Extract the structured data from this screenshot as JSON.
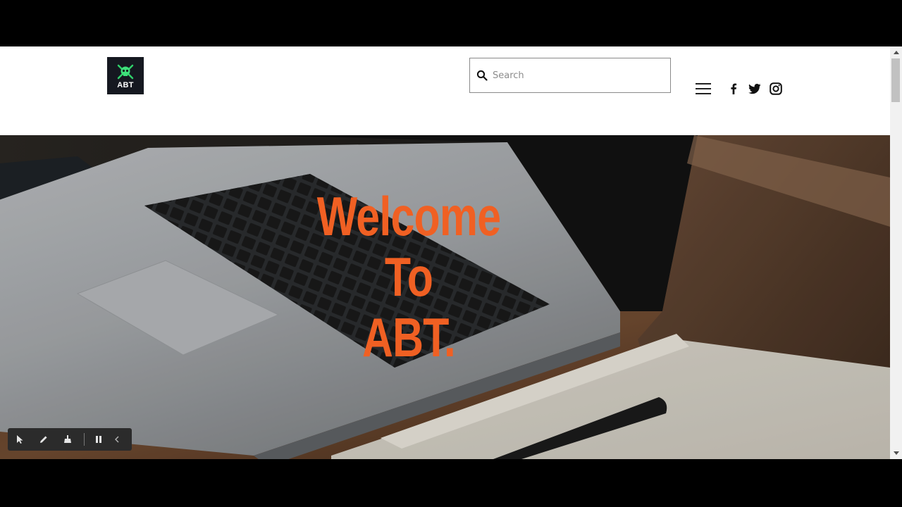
{
  "header": {
    "logo_text": "ABT",
    "search": {
      "placeholder": "Search",
      "value": ""
    },
    "social": [
      "facebook-icon",
      "twitter-icon",
      "instagram-icon"
    ]
  },
  "hero": {
    "title_lines": [
      "Welcome",
      "To",
      "ABT."
    ],
    "title_color": "#f06023"
  },
  "recording_toolbar": {
    "tools": [
      "pointer-icon",
      "pen-icon",
      "eraser-icon",
      "pause-icon",
      "chevron-left-icon"
    ]
  }
}
